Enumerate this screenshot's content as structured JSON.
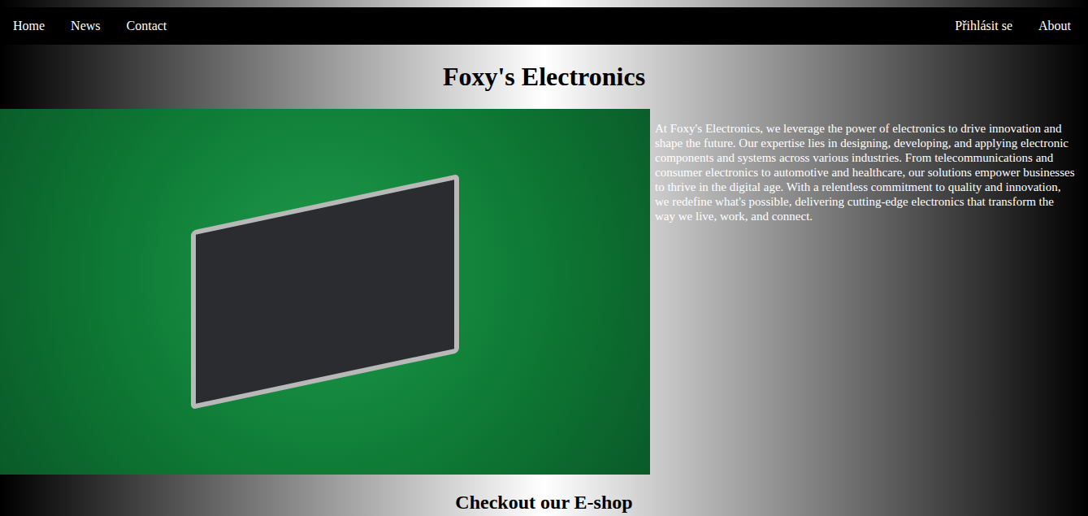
{
  "nav": {
    "left": [
      {
        "label": "Home"
      },
      {
        "label": "News"
      },
      {
        "label": "Contact"
      }
    ],
    "right": [
      {
        "label": "Přihlásit se"
      },
      {
        "label": "About"
      }
    ]
  },
  "title": "Foxy's Electronics",
  "hero": {
    "image": "circuit board photo",
    "text": "At Foxy's Electronics, we leverage the power of electronics to drive innovation and shape the future. Our expertise lies in designing, developing, and applying electronic components and systems across various industries. From telecommunications and consumer electronics to automotive and healthcare, our solutions empower businesses to thrive in the digital age. With a relentless commitment to quality and innovation, we redefine what's possible, delivering cutting-edge electronics that transform the way we live, work, and connect."
  },
  "subtitle": "Checkout our E-shop"
}
